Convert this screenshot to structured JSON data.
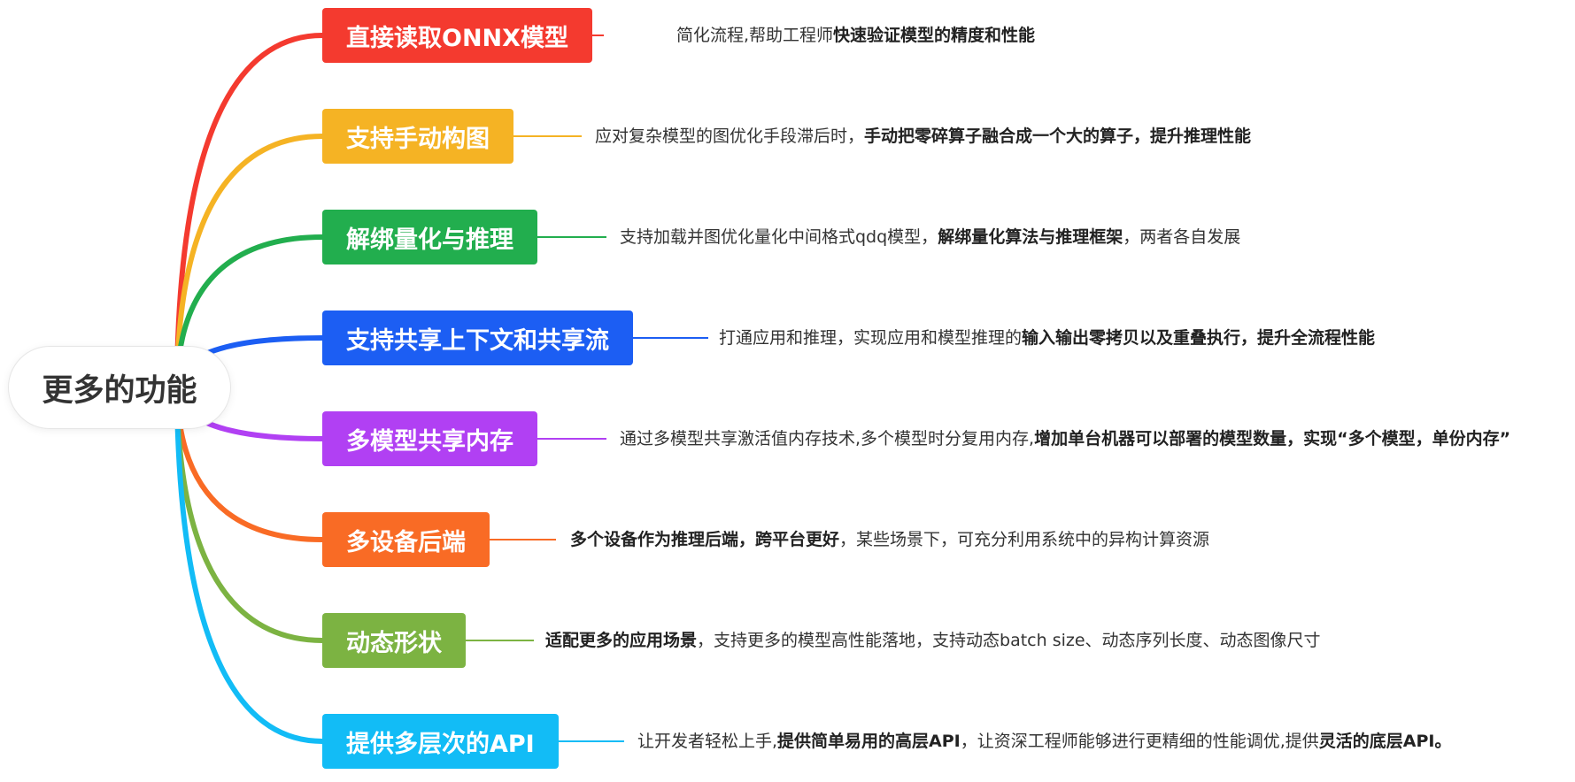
{
  "root": {
    "label": "更多的功能"
  },
  "branches": [
    {
      "label": "直接读取ONNX模型",
      "color": "#F43A2F",
      "desc": [
        {
          "text": "简化流程,帮助工程师",
          "bold": false
        },
        {
          "text": "快速验证模型的精度和性能",
          "bold": true
        }
      ]
    },
    {
      "label": "支持手动构图",
      "color": "#F5B324",
      "desc": [
        {
          "text": "应对复杂模型的图优化手段滞后时，",
          "bold": false
        },
        {
          "text": "手动把零碎算子融合成一个大的算子，提升推理性能",
          "bold": true
        }
      ]
    },
    {
      "label": "解绑量化与推理",
      "color": "#22AE4E",
      "desc": [
        {
          "text": "支持加载并图优化量化中间格式qdq模型，",
          "bold": false
        },
        {
          "text": "解绑量化算法与推理框架",
          "bold": true
        },
        {
          "text": "，两者各自发展",
          "bold": false
        }
      ]
    },
    {
      "label": "支持共享上下文和共享流",
      "color": "#1C5EF3",
      "desc": [
        {
          "text": "打通应用和推理，实现应用和模型推理的",
          "bold": false
        },
        {
          "text": "输入输出零拷贝以及重叠执行，提升全流程性能",
          "bold": true
        }
      ]
    },
    {
      "label": "多模型共享内存",
      "color": "#B140F3",
      "desc": [
        {
          "text": "通过多模型共享激活值内存技术,多个模型时分复用内存,",
          "bold": false
        },
        {
          "text": "增加单台机器可以部署的模型数量，实现“多个模型，单份内存”",
          "bold": true
        }
      ]
    },
    {
      "label": "多设备后端",
      "color": "#F96B25",
      "desc": [
        {
          "text": "多个设备作为推理后端，跨平台更好",
          "bold": true
        },
        {
          "text": "，某些场景下，可充分利用系统中的异构计算资源",
          "bold": false
        }
      ]
    },
    {
      "label": "动态形状",
      "color": "#7CB342",
      "desc": [
        {
          "text": "适配更多的应用场景",
          "bold": true
        },
        {
          "text": "，支持更多的模型高性能落地，支持动态batch size、动态序列长度、动态图像尺寸",
          "bold": false
        }
      ]
    },
    {
      "label": "提供多层次的API",
      "color": "#12BCF6",
      "desc": [
        {
          "text": "让开发者轻松上手,",
          "bold": false
        },
        {
          "text": "提供简单易用的高层API",
          "bold": true
        },
        {
          "text": "，让资深工程师能够进行更精细的性能调优,提供",
          "bold": false
        },
        {
          "text": "灵活的底层API。",
          "bold": true
        }
      ]
    }
  ]
}
